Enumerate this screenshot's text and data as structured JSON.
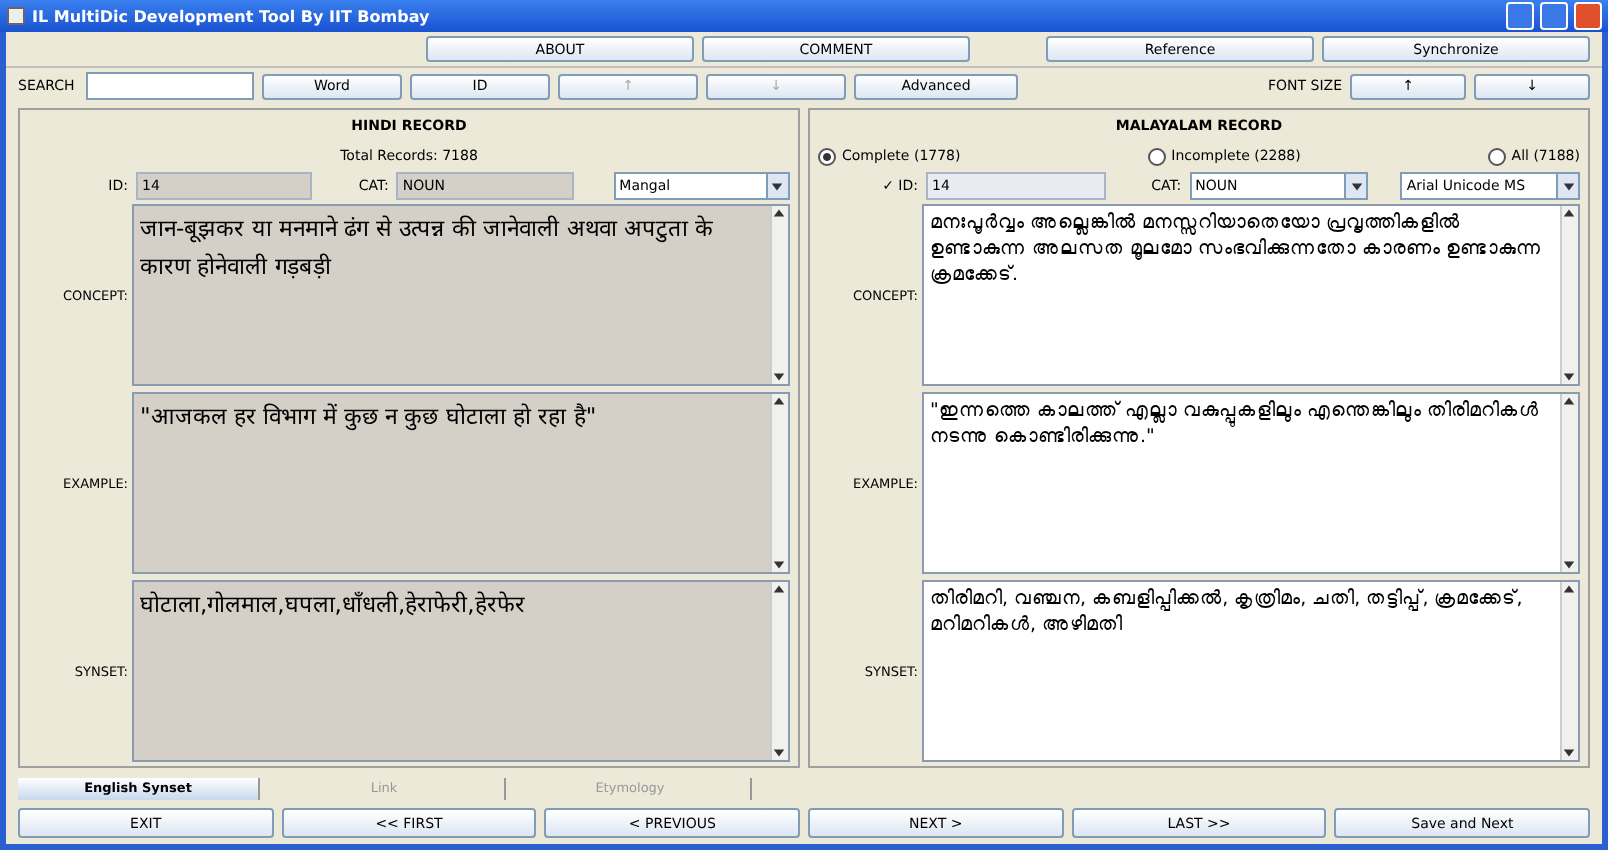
{
  "window": {
    "title": "IL MultiDic Development Tool By IIT Bombay"
  },
  "top_buttons": [
    {
      "label": "ABOUT"
    },
    {
      "label": "COMMENT"
    },
    {
      "label": "Reference"
    },
    {
      "label": "Synchronize"
    }
  ],
  "search": {
    "label": "SEARCH"
  },
  "search_buttons": [
    {
      "label": "Word",
      "disabled": false
    },
    {
      "label": "ID",
      "disabled": false
    },
    {
      "label": "↑",
      "disabled": true
    },
    {
      "label": "↓",
      "disabled": true
    },
    {
      "label": "Advanced",
      "disabled": false
    }
  ],
  "font_size": {
    "label": "FONT SIZE",
    "buttons": [
      "↑",
      "↓"
    ]
  },
  "hindi": {
    "heading": "HINDI RECORD",
    "total": "Total Records: 7188",
    "id_label": "ID:",
    "id_value": "14",
    "cat_label": "CAT:",
    "cat_value": "NOUN",
    "font": "Mangal",
    "fields": [
      {
        "label": "CONCEPT:",
        "text": "जान-बूझकर या मनमाने ढंग से उत्पन्न की जानेवाली अथवा अपटुता के कारण होनेवाली गड़बड़ी"
      },
      {
        "label": "EXAMPLE:",
        "text": "\"आजकल हर विभाग में कुछ न कुछ घोटाला हो रहा है\""
      },
      {
        "label": "SYNSET:",
        "text": "घोटाला,गोलमाल,घपला,धाँधली,हेराफेरी,हेरफेर"
      }
    ]
  },
  "malayalam": {
    "heading": "MALAYALAM RECORD",
    "filters": [
      {
        "label": "Complete (1778)",
        "selected": true
      },
      {
        "label": "Incomplete (2288)",
        "selected": false
      },
      {
        "label": "All (7188)",
        "selected": false
      }
    ],
    "id_label": "✓ ID:",
    "id_value": "14",
    "cat_label": "CAT:",
    "cat_value": "NOUN",
    "font": "Arial Unicode MS",
    "fields": [
      {
        "label": "CONCEPT:",
        "text": "മനഃപൂർവ്വം അല്ലെങ്കിൽ മനസ്സറിയാതെയോ പ്രവൃത്തികളിൽ ഉണ്ടാകുന്ന അലസത മൂലമോ സംഭവിക്കുന്നതോ കാരണം ഉണ്ടാകുന്ന ക്രമക്കേട്."
      },
      {
        "label": "EXAMPLE:",
        "text": "\"ഇന്നത്തെ കാലത്ത് എല്ലാ വകുപ്പുകളിലും എന്തെങ്കിലും തിരിമറികൾ നടന്നു കൊണ്ടിരിക്കുന്നു.\""
      },
      {
        "label": "SYNSET:",
        "text": "തിരിമറി, വഞ്ചന, കബളിപ്പിക്കൽ, കൃത്രിമം, ചതി, തട്ടിപ്പ്, ക്രമക്കേട്, മറിമറികൾ, അഴിമതി"
      }
    ]
  },
  "tabs": [
    {
      "label": "English Synset",
      "selected": true
    },
    {
      "label": "Link",
      "selected": false
    },
    {
      "label": "Etymology",
      "selected": false
    }
  ],
  "nav_buttons": [
    "EXIT",
    "<< FIRST",
    "< PREVIOUS",
    "NEXT >",
    "LAST >>",
    "Save and Next"
  ]
}
